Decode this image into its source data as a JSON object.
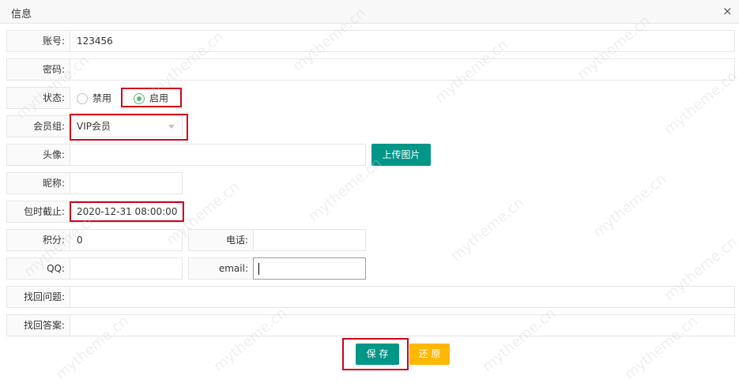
{
  "dialog": {
    "title": "信息",
    "close_glyph": "×"
  },
  "form": {
    "account_label": "账号:",
    "account_value": "123456",
    "password_label": "密码:",
    "password_value": "",
    "status_label": "状态:",
    "status_options": [
      {
        "label": "禁用",
        "checked": false
      },
      {
        "label": "启用",
        "checked": true
      }
    ],
    "group_label": "会员组:",
    "group_value": "VIP会员",
    "avatar_label": "头像:",
    "avatar_value": "",
    "upload_button": "上传图片",
    "nickname_label": "昵称:",
    "nickname_value": "",
    "expire_label": "包时截止:",
    "expire_value": "2020-12-31 08:00:00",
    "points_label": "积分:",
    "points_value": "0",
    "phone_label": "电话:",
    "phone_value": "",
    "qq_label": "QQ:",
    "qq_value": "",
    "email_label": "email:",
    "email_value": "",
    "question_label": "找回问题:",
    "question_value": "",
    "answer_label": "找回答案:",
    "answer_value": ""
  },
  "buttons": {
    "save": "保 存",
    "reset": "还 原"
  },
  "watermark": "mytheme.cn",
  "colors": {
    "primary": "#009688",
    "warning": "#FFB800",
    "radio_checked": "#5FB878",
    "highlight": "#d0021b"
  }
}
